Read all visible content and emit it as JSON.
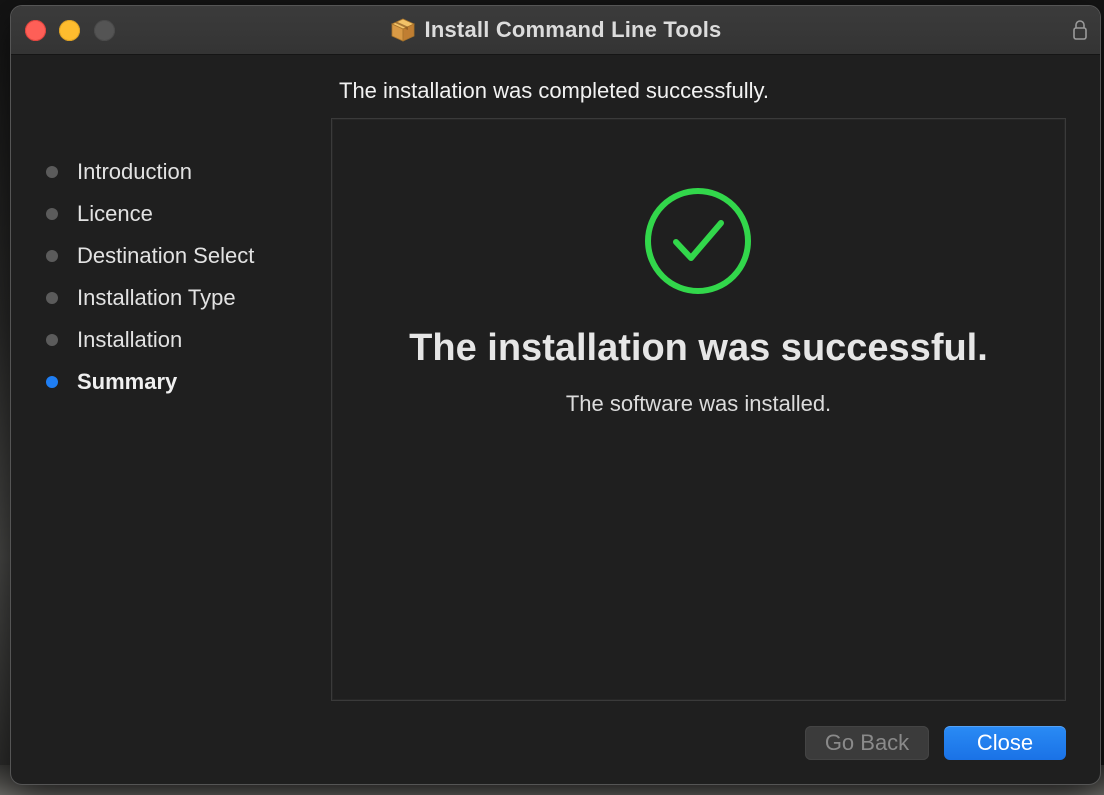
{
  "window": {
    "title": "Install Command Line Tools",
    "title_icon": "package-icon",
    "lock_icon": "lock-icon"
  },
  "sidebar": {
    "items": [
      {
        "label": "Introduction",
        "active": false
      },
      {
        "label": "Licence",
        "active": false
      },
      {
        "label": "Destination Select",
        "active": false
      },
      {
        "label": "Installation Type",
        "active": false
      },
      {
        "label": "Installation",
        "active": false
      },
      {
        "label": "Summary",
        "active": true
      }
    ]
  },
  "main": {
    "heading": "The installation was completed successfully.",
    "status_icon": "checkmark-circle-icon",
    "success_title": "The installation was successful.",
    "success_subtitle": "The software was installed."
  },
  "buttons": {
    "go_back": "Go Back",
    "close": "Close"
  },
  "colors": {
    "accent": "#1f7ef3",
    "success": "#32d74b",
    "traffic_close": "#fe5f57",
    "traffic_minimize": "#febc2e",
    "traffic_zoom": "#545454"
  }
}
